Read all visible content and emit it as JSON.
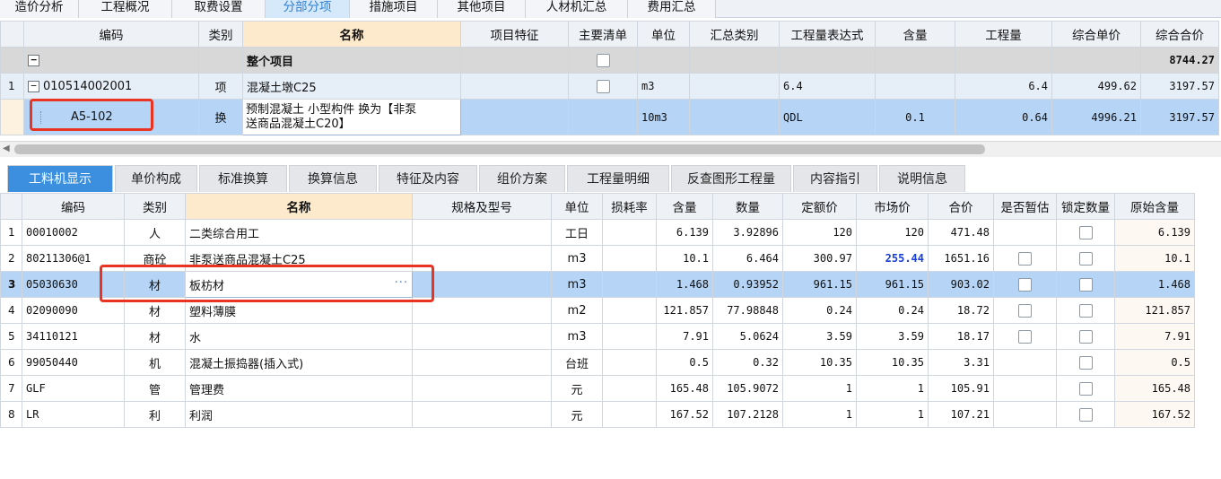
{
  "top_tabs": [
    "造价分析",
    "工程概况",
    "取费设置",
    "分部分项",
    "措施项目",
    "其他项目",
    "人材机汇总",
    "费用汇总"
  ],
  "active_top_tab": "分部分项",
  "upper_table": {
    "headers": [
      "编码",
      "类别",
      "名称",
      "项目特征",
      "主要清单",
      "单位",
      "汇总类别",
      "工程量表达式",
      "含量",
      "工程量",
      "综合单价",
      "综合合价"
    ],
    "group_row": {
      "tree": "−",
      "name": "整个项目",
      "total": "8744.27"
    },
    "item_row": {
      "idx": "1",
      "tree": "−",
      "code": "010514002001",
      "type": "项",
      "name": "混凝土墩C25",
      "unit": "m3",
      "expr": "6.4",
      "qty": "6.4",
      "unit_price": "499.62",
      "total": "3197.57"
    },
    "sub_row": {
      "code": "A5-102",
      "type": "换",
      "name_line1": "预制混凝土 小型构件  换为【非泵",
      "name_line2": "送商品混凝土C20】",
      "unit": "10m3",
      "expr": "QDL",
      "content": "0.1",
      "qty": "0.64",
      "unit_price": "4996.21",
      "total": "3197.57"
    }
  },
  "sub_tabs": [
    "工料机显示",
    "单价构成",
    "标准换算",
    "换算信息",
    "特征及内容",
    "组价方案",
    "工程量明细",
    "反查图形工程量",
    "内容指引",
    "说明信息"
  ],
  "active_sub_tab": "工料机显示",
  "lower_table": {
    "headers": [
      "编码",
      "类别",
      "名称",
      "规格及型号",
      "单位",
      "损耗率",
      "含量",
      "数量",
      "定额价",
      "市场价",
      "合价",
      "是否暂估",
      "锁定数量",
      "原始含量"
    ],
    "rows": [
      {
        "idx": "1",
        "code": "00010002",
        "type": "人",
        "name": "二类综合用工",
        "unit": "工日",
        "content": "6.139",
        "qty": "3.92896",
        "price": "120",
        "market": "120",
        "total": "471.48",
        "est": false,
        "lock": true,
        "orig": "6.139"
      },
      {
        "idx": "2",
        "code": "80211306@1",
        "type": "商砼",
        "name": "非泵送商品混凝土C25",
        "unit": "m3",
        "content": "10.1",
        "qty": "6.464",
        "price": "300.97",
        "market": "255.44",
        "total": "1651.16",
        "est": true,
        "lock": true,
        "orig": "10.1"
      },
      {
        "idx": "3",
        "code": "05030630",
        "type": "材",
        "name": "板枋材",
        "unit": "m3",
        "content": "1.468",
        "qty": "0.93952",
        "price": "961.15",
        "market": "961.15",
        "total": "903.02",
        "est": true,
        "lock": true,
        "orig": "1.468"
      },
      {
        "idx": "4",
        "code": "02090090",
        "type": "材",
        "name": "塑料薄膜",
        "unit": "m2",
        "content": "121.857",
        "qty": "77.98848",
        "price": "0.24",
        "market": "0.24",
        "total": "18.72",
        "est": true,
        "lock": true,
        "orig": "121.857"
      },
      {
        "idx": "5",
        "code": "34110121",
        "type": "材",
        "name": "水",
        "unit": "m3",
        "content": "7.91",
        "qty": "5.0624",
        "price": "3.59",
        "market": "3.59",
        "total": "18.17",
        "est": true,
        "lock": true,
        "orig": "7.91"
      },
      {
        "idx": "6",
        "code": "99050440",
        "type": "机",
        "name": "混凝土振捣器(插入式)",
        "unit": "台班",
        "content": "0.5",
        "qty": "0.32",
        "price": "10.35",
        "market": "10.35",
        "total": "3.31",
        "est": false,
        "lock": true,
        "orig": "0.5"
      },
      {
        "idx": "7",
        "code": "GLF",
        "type": "管",
        "name": "管理费",
        "unit": "元",
        "content": "165.48",
        "qty": "105.9072",
        "price": "1",
        "market": "1",
        "total": "105.91",
        "est": false,
        "lock": true,
        "orig": "165.48"
      },
      {
        "idx": "8",
        "code": "LR",
        "type": "利",
        "name": "利润",
        "unit": "元",
        "content": "167.52",
        "qty": "107.2128",
        "price": "1",
        "market": "1",
        "total": "107.21",
        "est": false,
        "lock": true,
        "orig": "167.52"
      }
    ],
    "ellipsis": "···"
  },
  "colors": {
    "accent": "#3b8fde",
    "highlight_row": "#b5d4f6",
    "market_price_changed": "#1a3ed8",
    "annotation_box": "#ea3323"
  }
}
